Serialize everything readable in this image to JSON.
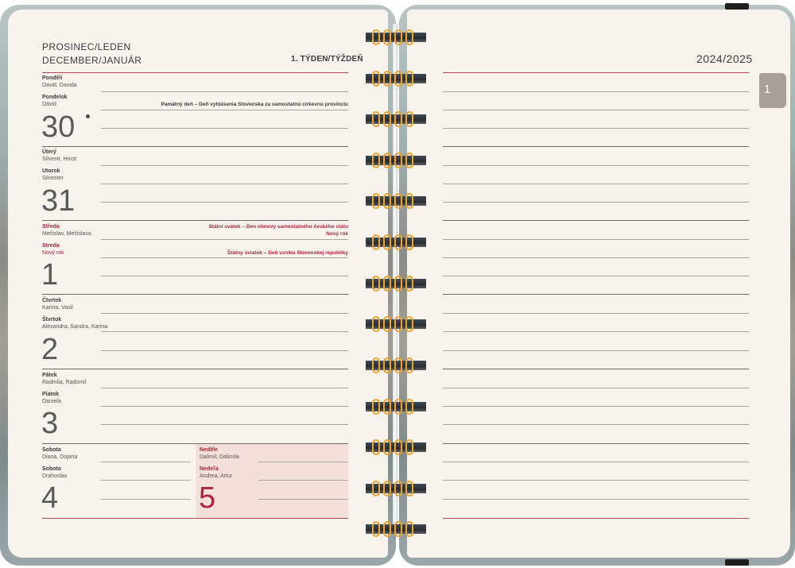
{
  "header": {
    "month_line1": "PROSINEC/LEDEN",
    "month_line2": "DECEMBER/JANUÁR",
    "week": "1. TÝDEN/TÝŽDEŇ",
    "year": "2024/2025"
  },
  "tab": {
    "label": "1"
  },
  "days": [
    {
      "cz_day": "Pondělí",
      "cz_names": "David, Davida",
      "sk_day": "Pondelok",
      "sk_names": "Dávid",
      "number": "30",
      "notes": [
        "Pamätný deň – Deň vyhlásenia Slovenska za samostatnú cirkevnú provinciu"
      ]
    },
    {
      "cz_day": "Úterý",
      "cz_names": "Silvestr, Horst",
      "sk_day": "Utorok",
      "sk_names": "Silvester",
      "number": "31",
      "notes": []
    },
    {
      "cz_day": "Středa",
      "cz_names": "Mečislav, Mečislava",
      "sk_day": "Streda",
      "sk_names": "Nový rok",
      "number": "1",
      "notes": [
        "Státní svátek – Den obnovy samostatného českého státu",
        "Nový rok",
        "Štátny sviatok – Deň vzniku Slovenskej republiky"
      ]
    },
    {
      "cz_day": "Čtvrtek",
      "cz_names": "Karina, Vasil",
      "sk_day": "Štvrtok",
      "sk_names": "Alexandra, Sandra, Karina",
      "number": "2",
      "notes": []
    },
    {
      "cz_day": "Pátek",
      "cz_names": "Radmila, Radomil",
      "sk_day": "Piatok",
      "sk_names": "Daniela",
      "number": "3",
      "notes": []
    },
    {
      "cz_day": "Sobota",
      "cz_names": "Diana, Dojana",
      "sk_day": "Sobota",
      "sk_names": "Drahoslav",
      "number": "4",
      "notes": []
    },
    {
      "cz_day": "Neděle",
      "cz_names": "Dalimil, Dalimila",
      "sk_day": "Nedeľa",
      "sk_names": "Andrea, Artur",
      "number": "5",
      "notes": []
    }
  ],
  "colors": {
    "accent": "#b0243c",
    "page": "#f9f3ed",
    "sunday_bg": "#f4e0da",
    "ring": "#f0a430"
  }
}
